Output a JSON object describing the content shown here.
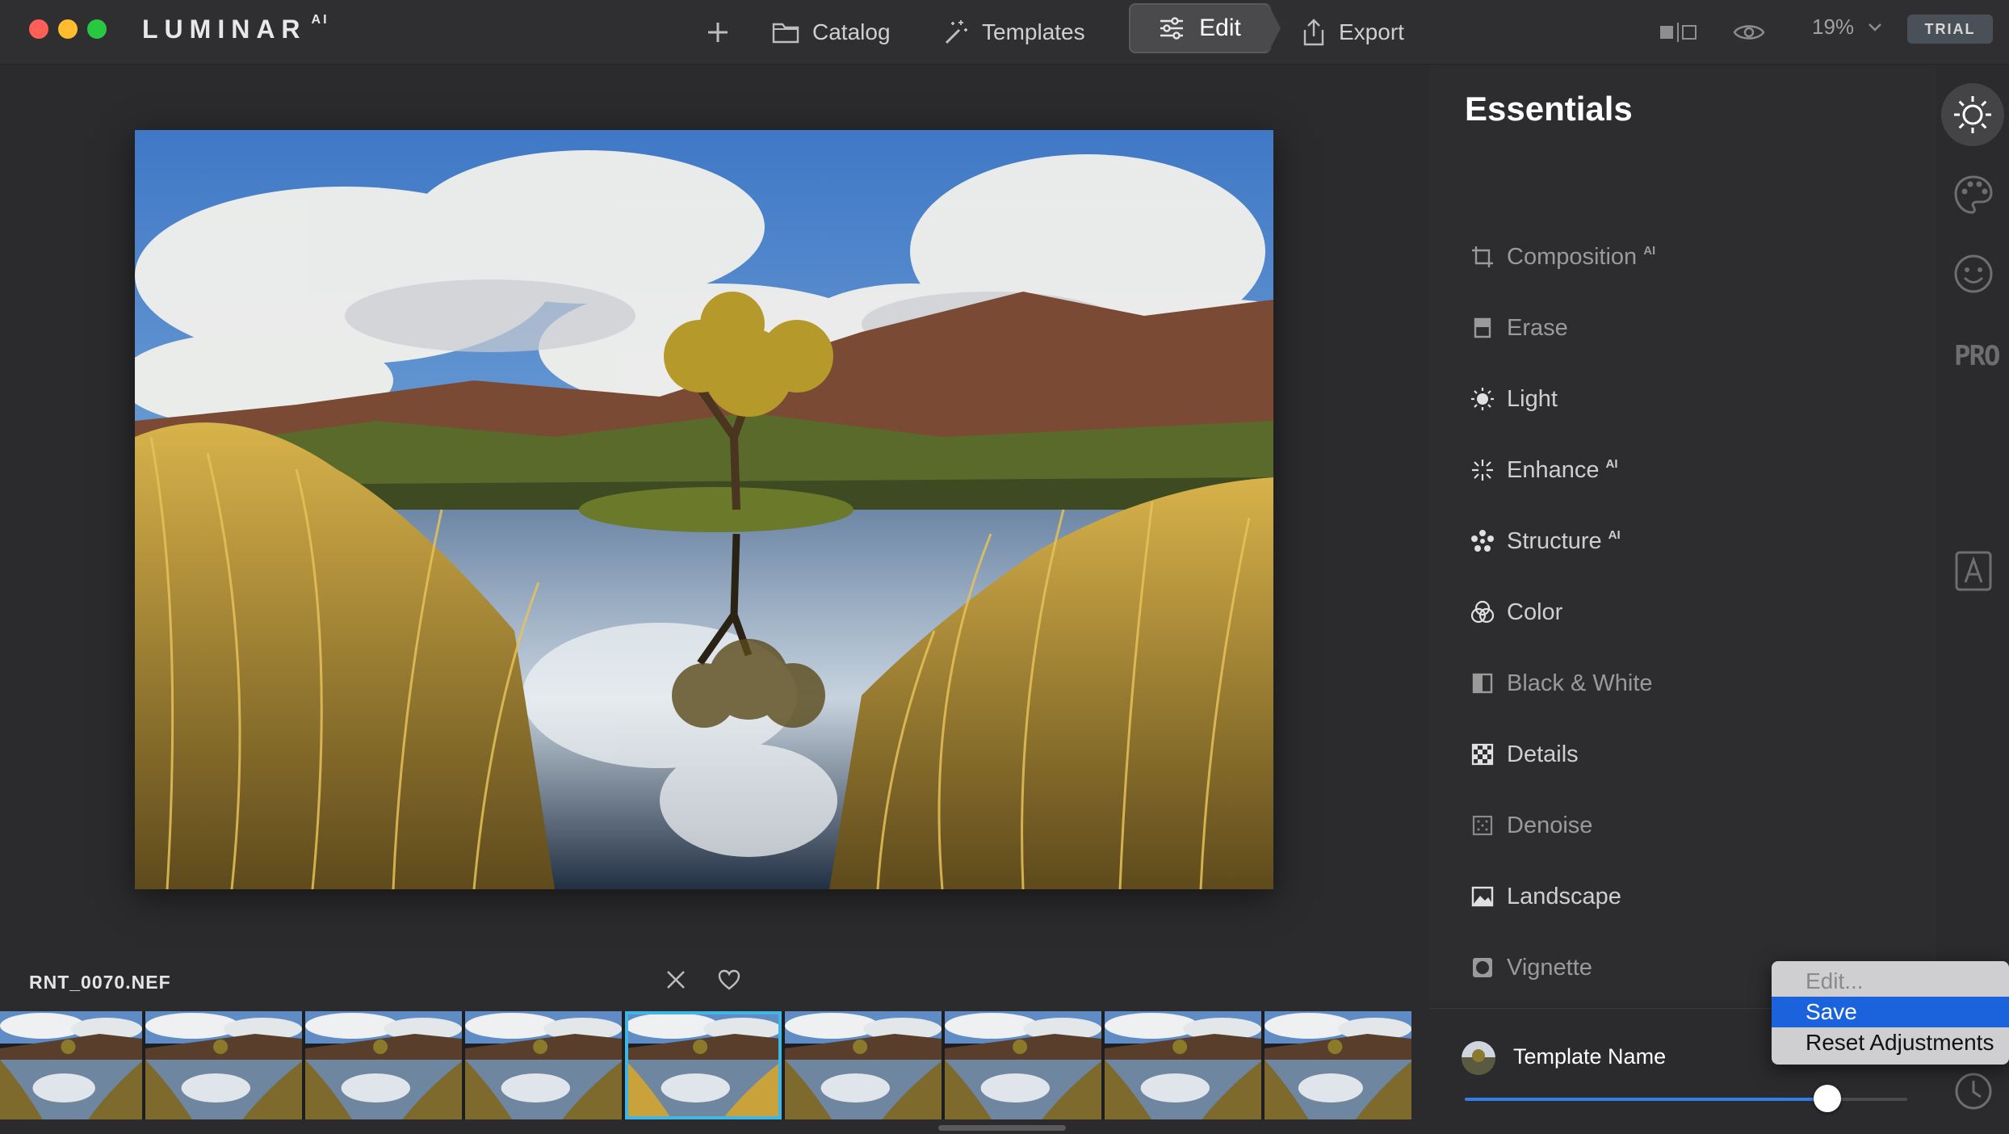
{
  "window": {
    "app_name": "LUMINAR",
    "app_superscript": "AI",
    "traffic_lights": [
      "#ff5f57",
      "#febc2e",
      "#28c840"
    ]
  },
  "toolbar": {
    "add_icon": "plus-icon",
    "catalog_label": "Catalog",
    "templates_label": "Templates",
    "edit_label": "Edit",
    "export_label": "Export",
    "zoom_level": "19%",
    "trial_label": "TRIAL"
  },
  "panel": {
    "title": "Essentials",
    "tools": [
      {
        "label": "Composition",
        "ai": "AI",
        "icon": "crop-icon"
      },
      {
        "label": "Erase",
        "ai": "",
        "icon": "eraser-icon"
      },
      {
        "label": "Light",
        "ai": "",
        "icon": "sun-icon"
      },
      {
        "label": "Enhance",
        "ai": "AI",
        "icon": "sparkle-icon"
      },
      {
        "label": "Structure",
        "ai": "AI",
        "icon": "structure-icon"
      },
      {
        "label": "Color",
        "ai": "",
        "icon": "color-circles-icon"
      },
      {
        "label": "Black & White",
        "ai": "",
        "icon": "bw-square-icon"
      },
      {
        "label": "Details",
        "ai": "",
        "icon": "checker-icon"
      },
      {
        "label": "Denoise",
        "ai": "",
        "icon": "denoise-icon"
      },
      {
        "label": "Landscape",
        "ai": "",
        "icon": "landscape-icon"
      },
      {
        "label": "Vignette",
        "ai": "",
        "icon": "vignette-icon"
      }
    ]
  },
  "rail": {
    "items": [
      "sun-icon",
      "palette-icon",
      "smiley-icon",
      "pro-label",
      "brush-frame-icon",
      "history-clock-icon"
    ],
    "pro_label": "PRO"
  },
  "template": {
    "name": "Template Name",
    "amount": 0.82
  },
  "context_menu": {
    "items": [
      {
        "label": "Edit...",
        "state": "disabled"
      },
      {
        "label": "Save",
        "state": "selected"
      },
      {
        "label": "Reset Adjustments",
        "state": "normal"
      }
    ]
  },
  "filmstrip": {
    "filename": "RNT_0070.NEF",
    "thumb_count": 9,
    "current_index": 4
  },
  "colors": {
    "accent": "#2f7fe8",
    "filmstrip_selection": "#3fb7e6"
  }
}
